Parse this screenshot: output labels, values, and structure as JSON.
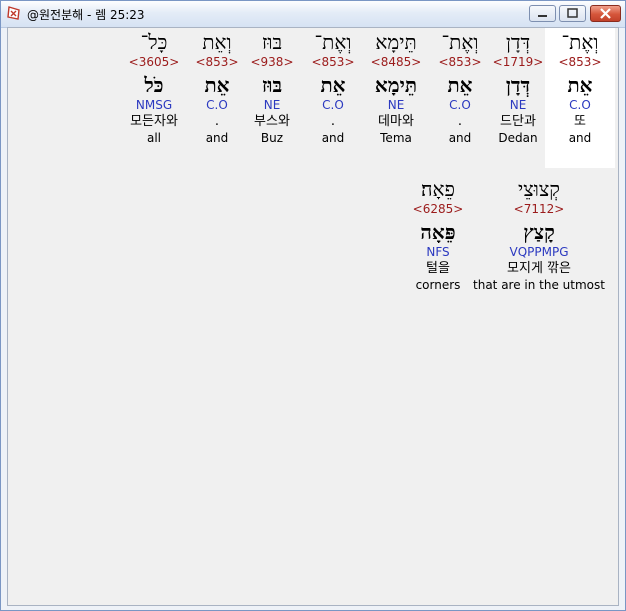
{
  "window": {
    "title": "@원전분해 - 렘 25:23"
  },
  "icons": {
    "app": "app-logo-icon",
    "minimize": "minimize-icon",
    "maximize": "maximize-icon",
    "close": "close-icon"
  },
  "words": [
    {
      "hebrew": "וְאֶת־",
      "strong": "<853>",
      "lemma": "אֵת",
      "parsing": "C.O",
      "korean": "또",
      "english": "and"
    },
    {
      "hebrew": "דְּדָן",
      "strong": "<1719>",
      "lemma": "דְּדָן",
      "parsing": "NE",
      "korean": "드단과",
      "english": "Dedan"
    },
    {
      "hebrew": "וְאֶת־",
      "strong": "<853>",
      "lemma": "אֵת",
      "parsing": "C.O",
      "korean": ".",
      "english": "and"
    },
    {
      "hebrew": "תֵּימָא",
      "strong": "<8485>",
      "lemma": "תֵּימָא",
      "parsing": "NE",
      "korean": "데마와",
      "english": "Tema"
    },
    {
      "hebrew": "וְאֶת־",
      "strong": "<853>",
      "lemma": "אֵת",
      "parsing": "C.O",
      "korean": ".",
      "english": "and"
    },
    {
      "hebrew": "בּוּז",
      "strong": "<938>",
      "lemma": "בּוּז",
      "parsing": "NE",
      "korean": "부스와",
      "english": "Buz"
    },
    {
      "hebrew": "וְאֵת",
      "strong": "<853>",
      "lemma": "אֵת",
      "parsing": "C.O",
      "korean": ".",
      "english": "and"
    },
    {
      "hebrew": "כָּל־",
      "strong": "<3605>",
      "lemma": "כֹּל",
      "parsing": "NMSG",
      "korean": "모든자와",
      "english": "all"
    },
    {
      "hebrew": "קְצוּצֵי",
      "strong": "<7112>",
      "lemma": "קָצַץ",
      "parsing": "VQPPMPG",
      "korean": "모지게 깎은",
      "english": "that are in the utmost"
    },
    {
      "hebrew": "פֵאָה׃",
      "strong": "<6285>",
      "lemma": "פֵּאָה",
      "parsing": "NFS",
      "korean": "털을",
      "english": "corners"
    }
  ]
}
